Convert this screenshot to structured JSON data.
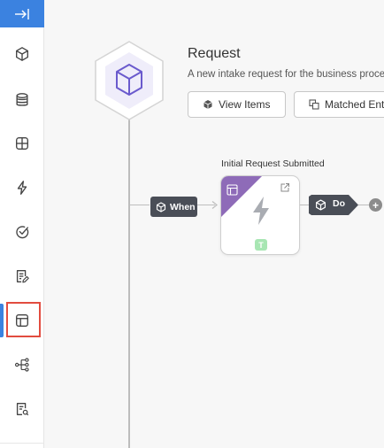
{
  "sidebar": {
    "collapse_icon": "collapse-right-icon",
    "items": [
      {
        "name": "cube-icon"
      },
      {
        "name": "database-icon"
      },
      {
        "name": "grid-icon"
      },
      {
        "name": "bolt-icon"
      },
      {
        "name": "check-circle-icon"
      },
      {
        "name": "document-edit-icon"
      },
      {
        "name": "layout-icon",
        "active": true
      },
      {
        "name": "workflow-icon"
      },
      {
        "name": "document-search-icon"
      }
    ],
    "accent_color": "#3b82e0",
    "highlight_color": "#e24c3f"
  },
  "request": {
    "title": "Request",
    "description": "A new intake request for the business process",
    "icon": "cube-icon",
    "view_items_label": "View Items",
    "matched_label": "Matched Entities"
  },
  "trigger": {
    "when_label": "When",
    "node_title": "Initial Request Submitted",
    "node_icon": "bolt-icon",
    "badge": "T",
    "do_label": "Do",
    "add_label": "+",
    "corner_color": "#8e6bb8"
  }
}
